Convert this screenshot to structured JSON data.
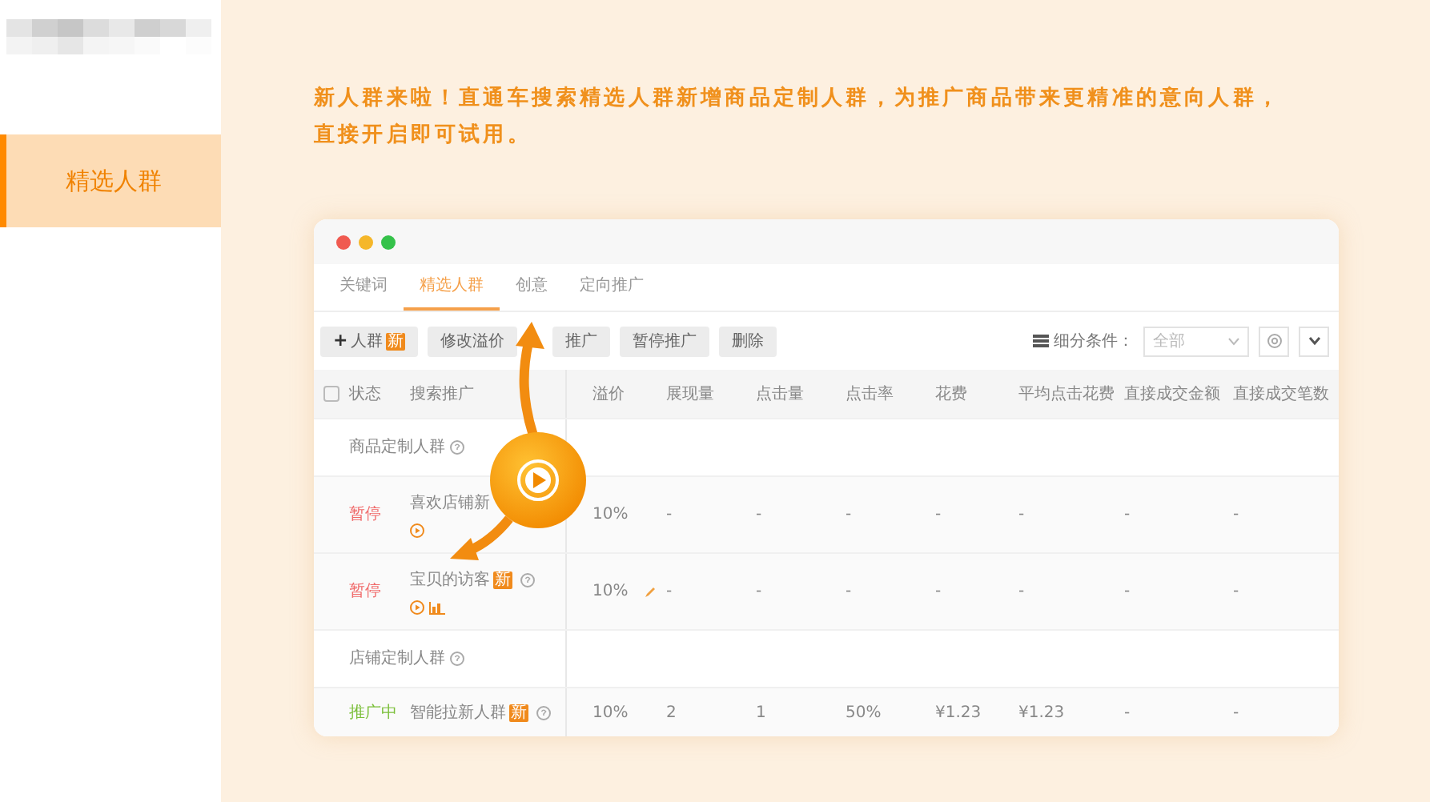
{
  "sidebar": {
    "items": [
      {
        "label": "精选人群",
        "selected": true
      }
    ]
  },
  "banner": {
    "text": "新人群来啦！直通车搜索精选人群新增商品定制人群，为推广商品带来更精准的意向人群，直接开启即可试用。"
  },
  "app_window": {
    "tabs": [
      {
        "label": "关键词",
        "selected": false
      },
      {
        "label": "精选人群",
        "selected": true
      },
      {
        "label": "创意",
        "selected": false
      },
      {
        "label": "定向推广",
        "selected": false
      }
    ],
    "toolbar": {
      "buttons": [
        {
          "kind": "add",
          "icon": "+",
          "label": "人群",
          "badge": "新"
        },
        {
          "kind": "plain",
          "label": "修改溢价"
        },
        {
          "kind": "plain",
          "label": "推广"
        },
        {
          "kind": "plain",
          "label": "暂停推广"
        },
        {
          "kind": "plain",
          "label": "删除"
        }
      ],
      "filter_label": "细分条件：",
      "filter_value": "全部"
    },
    "table": {
      "select_all_checked": false,
      "columns": [
        "状态",
        "搜索推广",
        "溢价",
        "展现量",
        "点击量",
        "点击率",
        "花费",
        "平均点击花费",
        "直接成交金额",
        "直接成交笔数"
      ],
      "rows": [
        {
          "kind": "group",
          "label": "商品定制人群"
        },
        {
          "kind": "item",
          "status": "暂停",
          "color": "#f06a6a",
          "name": "喜欢店铺新",
          "help": false,
          "chart": false,
          "editable": false,
          "values": [
            "10%",
            "-",
            "-",
            "-",
            "-",
            "-",
            "-",
            "-"
          ]
        },
        {
          "kind": "item",
          "status": "暂停",
          "color": "#f06a6a",
          "name": "宝贝的访客",
          "badge": "新",
          "help": true,
          "chart": true,
          "editable": true,
          "values": [
            "10%",
            "-",
            "-",
            "-",
            "-",
            "-",
            "-",
            "-"
          ]
        },
        {
          "kind": "group",
          "label": "店铺定制人群"
        },
        {
          "kind": "item",
          "status": "推广中",
          "color": "#7bbf3a",
          "name": "智能拉新人群",
          "badge": "新",
          "help": true,
          "chart": false,
          "editable": false,
          "values": [
            "10%",
            "2",
            "1",
            "50%",
            "¥1.23",
            "¥1.23",
            "-",
            "-"
          ]
        }
      ]
    }
  }
}
